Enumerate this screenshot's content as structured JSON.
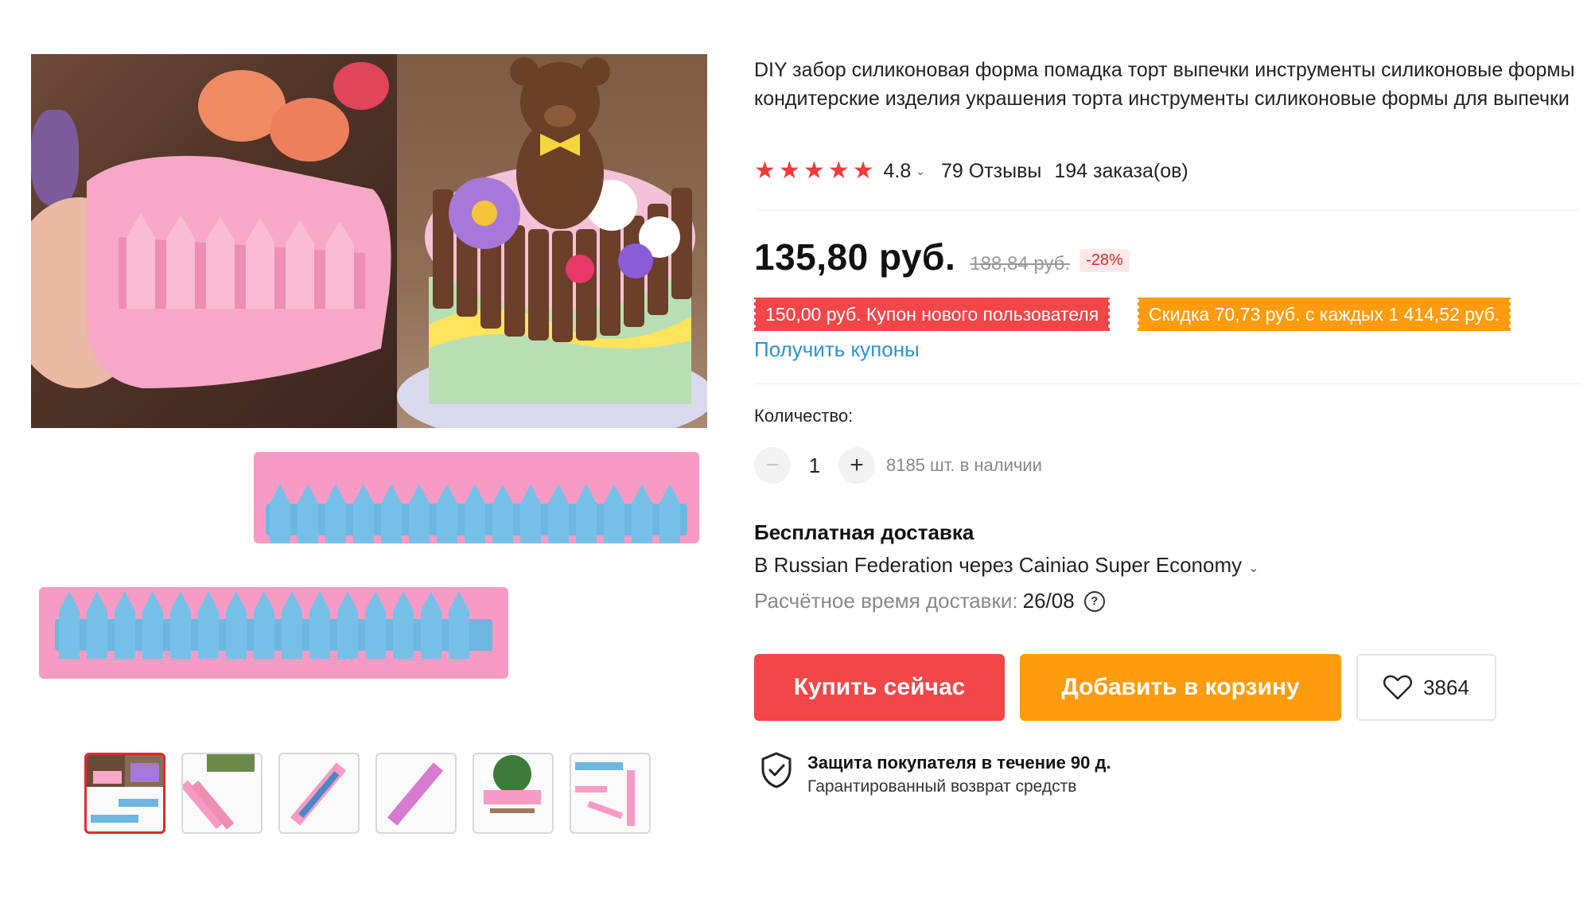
{
  "product": {
    "title": "DIY забор силиконовая форма помадка торт выпечки инструменты силиконовые формы кондитерские изделия украшения торта инструменты силиконовые формы для выпечки",
    "rating": "4.8",
    "reviews": "79 Отзывы",
    "orders": "194 заказа(ов)"
  },
  "price": {
    "current": "135,80 руб.",
    "original": "188,84 руб.",
    "discount": "-28%"
  },
  "coupons": {
    "new_user": "150,00 руб. Купон нового пользователя",
    "store": "Скидка 70,73 руб. с каждых 1 414,52 руб.",
    "get_label": "Получить купоны"
  },
  "quantity": {
    "label": "Количество:",
    "value": "1",
    "stock": "8185 шт. в наличии"
  },
  "shipping": {
    "title": "Бесплатная доставка",
    "route": "В Russian Federation через Cainiao Super Economy",
    "time_label": "Расчётное время доставки:",
    "date": "26/08"
  },
  "actions": {
    "buy": "Купить сейчас",
    "cart": "Добавить в корзину",
    "wishlist_count": "3864"
  },
  "protection": {
    "title": "Защита покупателя в течение 90 д.",
    "subtitle": "Гарантированный возврат средств"
  },
  "colors": {
    "accent_red": "#f24648",
    "accent_orange": "#ff9b0f",
    "star": "#f23a3a",
    "link": "#2a94d6"
  },
  "icons": [
    "star-icon",
    "chevron-down-icon",
    "minus-icon",
    "plus-icon",
    "help-icon",
    "heart-icon",
    "shield-check-icon"
  ]
}
